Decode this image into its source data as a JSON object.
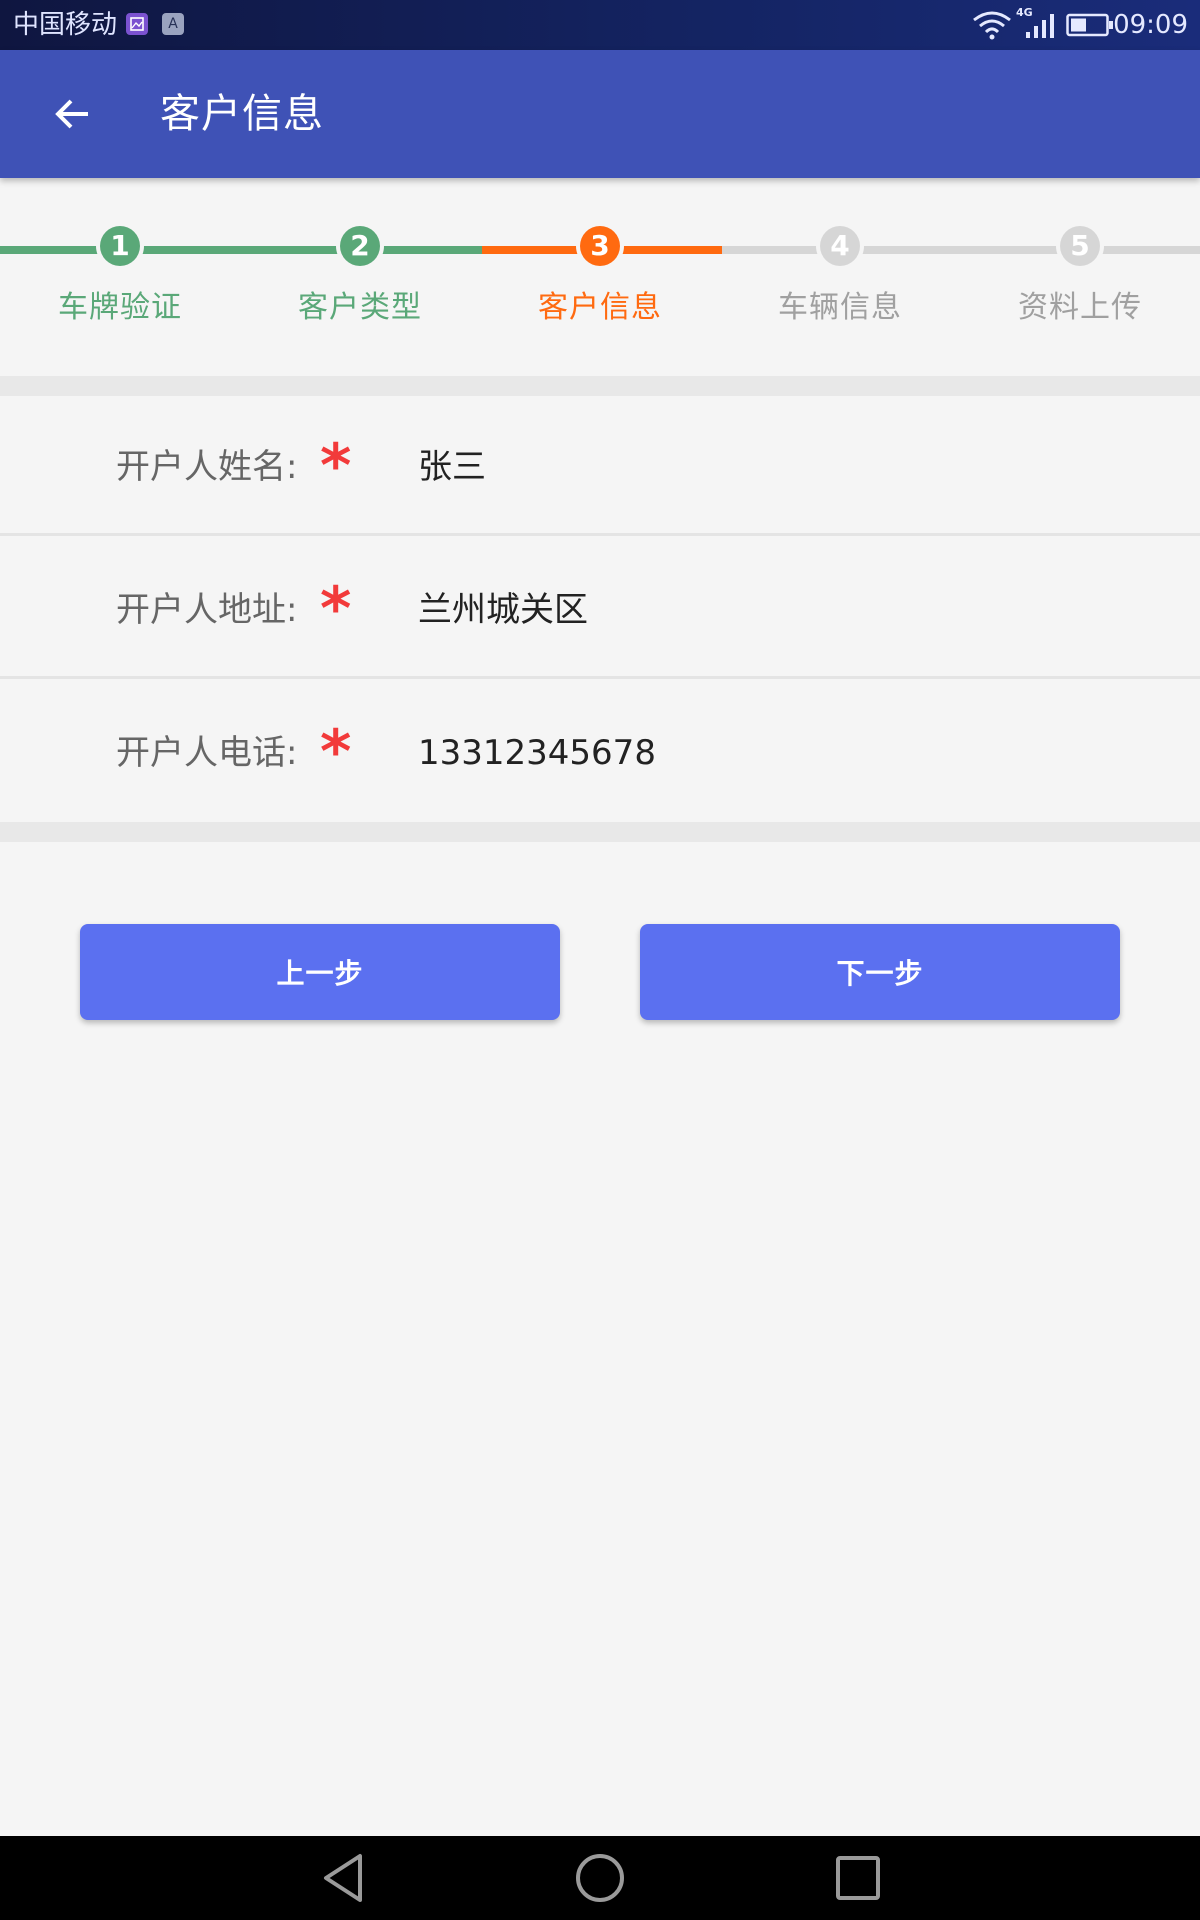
{
  "status_bar": {
    "carrier": "中国移动",
    "notification_icons": [
      "gallery-icon",
      "letter-a-icon"
    ],
    "notification_letter": "A",
    "network_type": "4G",
    "time": "09:09"
  },
  "app_bar": {
    "title": "客户信息",
    "back_icon": "arrow-left-icon"
  },
  "stepper": {
    "colors": {
      "completed": "#5aa878",
      "current": "#ff6a10",
      "pending": "#d6d6d6",
      "pending_text": "#a0a0a0"
    },
    "steps": [
      {
        "number": "1",
        "label": "车牌验证",
        "state": "completed"
      },
      {
        "number": "2",
        "label": "客户类型",
        "state": "completed"
      },
      {
        "number": "3",
        "label": "客户信息",
        "state": "current"
      },
      {
        "number": "4",
        "label": "车辆信息",
        "state": "pending"
      },
      {
        "number": "5",
        "label": "资料上传",
        "state": "pending"
      }
    ]
  },
  "form": {
    "required_mark": "*",
    "fields": [
      {
        "label": "开户人姓名:",
        "value": "张三"
      },
      {
        "label": "开户人地址:",
        "value": "兰州城关区"
      },
      {
        "label": "开户人电话:",
        "value": "13312345678"
      }
    ]
  },
  "buttons": {
    "previous": "上一步",
    "next": "下一步",
    "color": "#5b70f0"
  },
  "nav_bar": {
    "icons": [
      "back-triangle-icon",
      "home-circle-icon",
      "recents-square-icon"
    ]
  }
}
